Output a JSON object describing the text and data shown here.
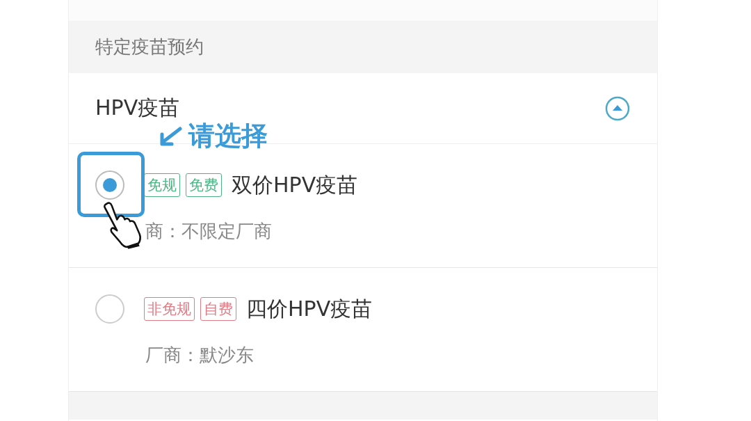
{
  "section": {
    "title": "特定疫苗预约"
  },
  "group": {
    "title": "HPV疫苗",
    "expanded": true
  },
  "options": [
    {
      "tags": [
        {
          "label": "免规",
          "color": "#4cb583"
        },
        {
          "label": "免费",
          "color": "#4cb583"
        }
      ],
      "name": "双价HPV疫苗",
      "vendor": "商：不限定厂商",
      "selected": true
    },
    {
      "tags": [
        {
          "label": "非免规",
          "color": "#e07c86"
        },
        {
          "label": "自费",
          "color": "#e07c86"
        }
      ],
      "name": "四价HPV疫苗",
      "vendor": "厂商：默沙东",
      "selected": false
    }
  ],
  "annotation": {
    "text": "请选择"
  }
}
